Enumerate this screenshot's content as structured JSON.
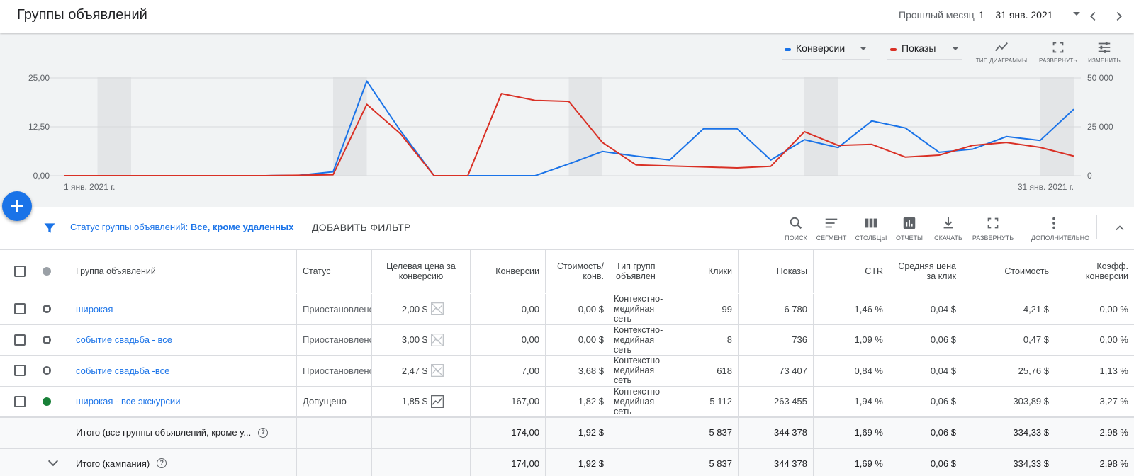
{
  "header": {
    "title": "Группы объявлений",
    "date_preset": "Прошлый месяц",
    "date_range": "1 – 31 янв. 2021"
  },
  "chart": {
    "metrics": [
      {
        "label": "Конверсии",
        "color": "#1a73e8"
      },
      {
        "label": "Показы",
        "color": "#d93025"
      }
    ],
    "buttons": {
      "chart_type": "ТИП ДИАГРАММЫ",
      "expand": "РАЗВЕРНУТЬ",
      "edit": "ИЗМЕНИТЬ"
    }
  },
  "chart_data": {
    "type": "line",
    "x": [
      "1 янв. 2021 г.",
      "2",
      "3",
      "4",
      "5",
      "6",
      "7",
      "8",
      "9",
      "10",
      "11",
      "12",
      "13",
      "14",
      "15",
      "16",
      "17",
      "18",
      "19",
      "20",
      "21",
      "22",
      "23",
      "24",
      "25",
      "26",
      "27",
      "28",
      "29",
      "30",
      "31 янв. 2021 г."
    ],
    "x_tick_labels": [
      "1 янв. 2021 г.",
      "31 янв. 2021 г."
    ],
    "series": [
      {
        "name": "Конверсии",
        "axis": "left",
        "color": "#1a73e8",
        "values": [
          0,
          0,
          0,
          0,
          0,
          0,
          0,
          0.1,
          1.0,
          24.2,
          11.5,
          0,
          0,
          0,
          0,
          3,
          6.2,
          5,
          4,
          12,
          12,
          4,
          9.2,
          7.2,
          14,
          12.2,
          6,
          6.8,
          10,
          9,
          17
        ]
      },
      {
        "name": "Показы",
        "axis": "right",
        "color": "#d93025",
        "values": [
          0,
          0,
          0,
          0,
          0,
          0,
          0,
          200,
          500,
          36500,
          21500,
          0,
          0,
          42000,
          38500,
          38000,
          17000,
          5500,
          5000,
          4500,
          4000,
          4800,
          22500,
          15500,
          16000,
          9500,
          10500,
          15500,
          17000,
          14500,
          10000
        ]
      }
    ],
    "y_left": {
      "ticks": [
        "0,00",
        "12,50",
        "25,00"
      ],
      "ylim": [
        0,
        25
      ]
    },
    "y_right": {
      "ticks": [
        "0",
        "25 000",
        "50 000"
      ],
      "ylim": [
        0,
        50000
      ]
    },
    "weekend_bands": [
      "2–3",
      "9–10",
      "16–17",
      "23–24",
      "30–31"
    ],
    "grid": true
  },
  "filter": {
    "label": "Статус группы объявлений:",
    "value": "Все, кроме удаленных",
    "add_filter": "ДОБАВИТЬ ФИЛЬТР"
  },
  "tools": [
    {
      "icon": "search-icon",
      "label": "ПОИСК"
    },
    {
      "icon": "segment-icon",
      "label": "СЕГМЕНТ"
    },
    {
      "icon": "columns-icon",
      "label": "СТОЛБЦЫ"
    },
    {
      "icon": "reports-icon",
      "label": "ОТЧЕТЫ"
    },
    {
      "icon": "download-icon",
      "label": "СКАЧАТЬ"
    },
    {
      "icon": "fullscreen-icon",
      "label": "РАЗВЕРНУТЬ"
    },
    {
      "icon": "more-icon",
      "label": "ДОПОЛНИТЕЛЬНО"
    }
  ],
  "table": {
    "columns": [
      "Группа объявлений",
      "Статус",
      "Целевая цена за конверсию",
      "Конверсии",
      "Стоимость/ конв.",
      "Тип групп объявлен",
      "Клики",
      "Показы",
      "CTR",
      "Средняя цена за клик",
      "Стоимость",
      "Коэфф. конверсии"
    ],
    "rows": [
      {
        "name": "широкая",
        "status": "Приостановлено",
        "status_icon": "paused",
        "target": "2,00 $",
        "chart_icon": "chart-disabled-icon",
        "conv": "0,00",
        "cost_conv": "0,00 $",
        "type": "Контекстно-медийная сеть",
        "clicks": "99",
        "impr": "6 780",
        "ctr": "1,46 %",
        "cpc": "0,04 $",
        "cost": "4,21 $",
        "conv_rate": "0,00 %"
      },
      {
        "name": "событие свадьба - все",
        "status": "Приостановлено",
        "status_icon": "paused",
        "target": "3,00 $",
        "chart_icon": "chart-disabled-icon",
        "conv": "0,00",
        "cost_conv": "0,00 $",
        "type": "Контекстно-медийная сеть",
        "clicks": "8",
        "impr": "736",
        "ctr": "1,09 %",
        "cpc": "0,06 $",
        "cost": "0,47 $",
        "conv_rate": "0,00 %"
      },
      {
        "name": "событие свадьба -все",
        "status": "Приостановлено",
        "status_icon": "paused",
        "target": "2,47 $",
        "chart_icon": "chart-disabled-icon",
        "conv": "7,00",
        "cost_conv": "3,68 $",
        "type": "Контекстно-медийная сеть",
        "clicks": "618",
        "impr": "73 407",
        "ctr": "0,84 %",
        "cpc": "0,04 $",
        "cost": "25,76 $",
        "conv_rate": "1,13 %"
      },
      {
        "name": "широкая - все экскурсии",
        "status": "Допущено",
        "status_icon": "ok",
        "target": "1,85 $",
        "chart_icon": "chart-icon",
        "conv": "167,00",
        "cost_conv": "1,82 $",
        "type": "Контекстно-медийная сеть",
        "clicks": "5 112",
        "impr": "263 455",
        "ctr": "1,94 %",
        "cpc": "0,06 $",
        "cost": "303,89 $",
        "conv_rate": "3,27 %"
      }
    ],
    "totals": [
      {
        "label": "Итого (все группы объявлений, кроме у...",
        "conv": "174,00",
        "cost_conv": "1,92 $",
        "clicks": "5 837",
        "impr": "344 378",
        "ctr": "1,69 %",
        "cpc": "0,06 $",
        "cost": "334,33 $",
        "conv_rate": "2,98 %"
      },
      {
        "label": "Итого (кампания)",
        "conv": "174,00",
        "cost_conv": "1,92 $",
        "clicks": "5 837",
        "impr": "344 378",
        "ctr": "1,69 %",
        "cpc": "0,06 $",
        "cost": "334,33 $",
        "conv_rate": "2,98 %"
      }
    ]
  }
}
